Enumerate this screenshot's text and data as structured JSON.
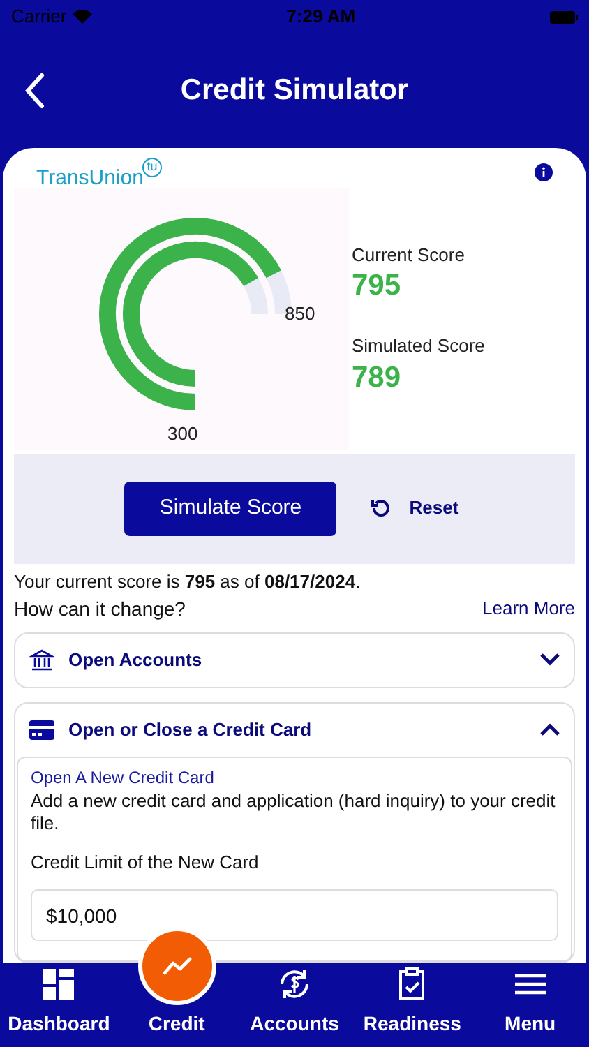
{
  "status_bar": {
    "carrier": "Carrier",
    "time": "7:29 AM"
  },
  "header": {
    "title": "Credit Simulator"
  },
  "brand": {
    "name": "TransUnion",
    "mark": "tu"
  },
  "gauge": {
    "min": "300",
    "max": "850"
  },
  "scores": [
    {
      "label": "Current Score",
      "value": "795"
    },
    {
      "label": "Simulated Score",
      "value": "789"
    }
  ],
  "actions": {
    "simulate": "Simulate Score",
    "reset": "Reset"
  },
  "summary": {
    "text": "Your current score is **795** as of **08/17/2024**.",
    "question": "How can it change?",
    "link": "Learn More"
  },
  "sections": [
    {
      "kind": "bank",
      "title": "Open Accounts",
      "expanded": false
    },
    {
      "kind": "card",
      "title": "Open or Close a Credit Card",
      "expanded": true,
      "option": "Open A New Credit Card",
      "description": "Add a new credit card and application (hard inquiry) to your credit file.",
      "field_label": "Credit Limit of the New Card",
      "field_value": "$10,000"
    }
  ],
  "nav": [
    {
      "kind": "dashboard",
      "label": "Dashboard",
      "selected": false
    },
    {
      "kind": "credit",
      "label": "Credit",
      "selected": true
    },
    {
      "kind": "accounts",
      "label": "Accounts",
      "selected": false
    },
    {
      "kind": "readiness",
      "label": "Readiness",
      "selected": false
    },
    {
      "kind": "menu",
      "label": "Menu",
      "selected": false
    }
  ]
}
